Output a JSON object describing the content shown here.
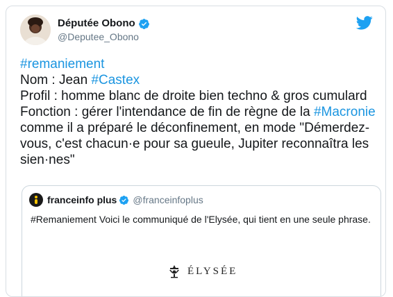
{
  "tweet": {
    "author_name": "Députée Obono",
    "author_handle": "@Deputee_Obono",
    "lines": [
      [
        {
          "t": "#remaniement",
          "link": true
        }
      ],
      [
        {
          "t": "Nom : Jean ",
          "link": false
        },
        {
          "t": "#Castex",
          "link": true
        }
      ],
      [
        {
          "t": "Profil : homme blanc de droite bien techno & gros cumulard",
          "link": false
        }
      ],
      [
        {
          "t": "Fonction : gérer l'intendance de fin de règne de la ",
          "link": false
        },
        {
          "t": "#Macronie",
          "link": true
        }
      ],
      [
        {
          "t": "comme il a préparé le déconfinement, en mode \"Démerdez-",
          "link": false
        }
      ],
      [
        {
          "t": "vous, c'est chacun·e pour sa gueule, Jupiter reconnaîtra les",
          "link": false
        }
      ],
      [
        {
          "t": "sien·nes\"",
          "link": false
        }
      ]
    ]
  },
  "quote": {
    "name": "franceinfo plus",
    "handle": "@franceinfoplus",
    "text": "#Remaniement Voici le communiqué de l'Elysée, qui tient en une seule phrase.",
    "logo_text": "ÉLYSÉE"
  },
  "icons": {
    "bird": "twitter-bird-icon",
    "verified": "verified-badge-icon"
  },
  "colors": {
    "link": "#1b95e0",
    "verified": "#1da1f2",
    "franceinfo_yellow": "#f6c300"
  }
}
